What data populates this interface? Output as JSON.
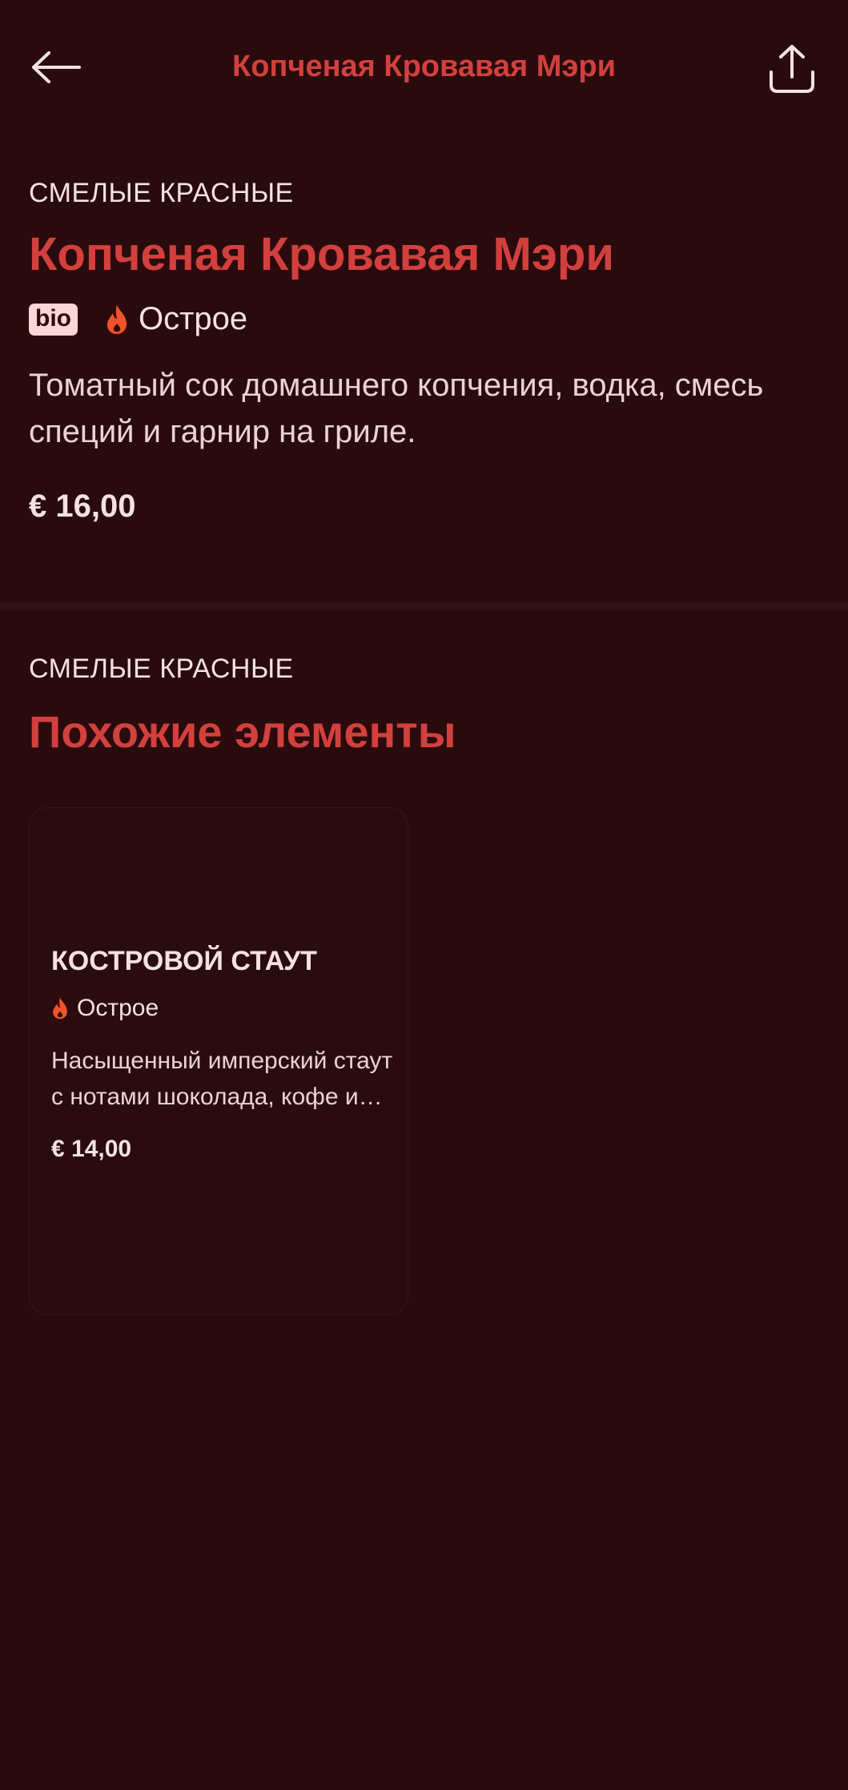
{
  "header": {
    "title": "Копченая Кровавая Мэри",
    "back_icon": "arrow-left-icon",
    "share_icon": "share-icon"
  },
  "product": {
    "category": "СМЕЛЫЕ КРАСНЫЕ",
    "name": "Копченая Кровавая Мэри",
    "bio_badge": "bio",
    "spicy_label": "Острое",
    "description": "Томатный сок домашнего копчения, водка, смесь специй и гарнир на гриле.",
    "price": "€ 16,00"
  },
  "related": {
    "category": "СМЕЛЫЕ КРАСНЫЕ",
    "title": "Похожие элементы",
    "items": [
      {
        "name": "КОСТРОВОЙ СТАУТ",
        "spicy_label": "Острое",
        "description": "Насыщенный имперский стаут с нотами шоколада, кофе и дыма.",
        "price": "€ 14,00"
      }
    ]
  },
  "colors": {
    "background": "#2a0b0d",
    "accent": "#d2403e",
    "text": "#f3e2e0",
    "fire": "#f0532c",
    "badge_bg": "#fbd6d4"
  }
}
